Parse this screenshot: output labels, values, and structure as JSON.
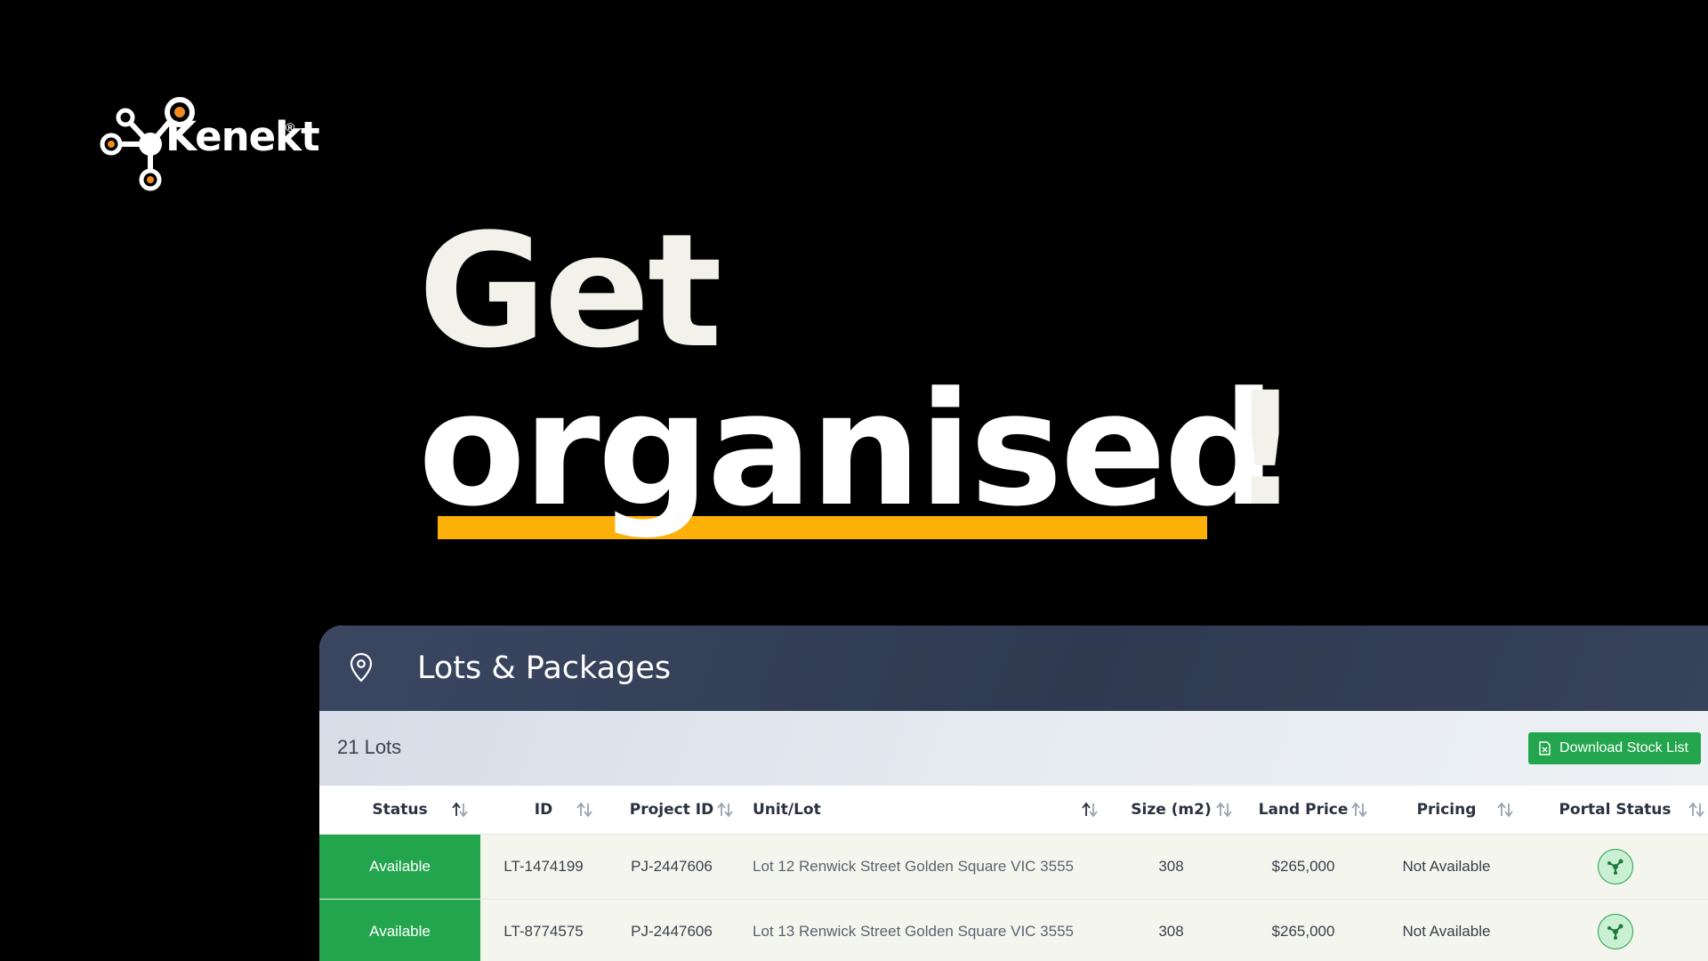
{
  "brand": {
    "name": "Kenekt",
    "reg": "®"
  },
  "hero": {
    "line1": "Get",
    "line2": "organised",
    "bang": "!"
  },
  "panel": {
    "title": "Lots & Packages",
    "lots_count": "21 Lots",
    "download_label": "Download Stock List",
    "columns": [
      "Status",
      "ID",
      "Project ID",
      "Unit/Lot",
      "Size (m2)",
      "Land Price",
      "Pricing",
      "Portal Status"
    ],
    "rows": [
      {
        "status": "Available",
        "id": "LT-1474199",
        "project_id": "PJ-2447606",
        "unit": "Lot 12 Renwick Street Golden Square VIC 3555",
        "size": "308",
        "price": "$265,000",
        "pricing": "Not Available"
      },
      {
        "status": "Available",
        "id": "LT-8774575",
        "project_id": "PJ-2447606",
        "unit": "Lot 13 Renwick Street Golden Square VIC 3555",
        "size": "308",
        "price": "$265,000",
        "pricing": "Not Available"
      }
    ]
  },
  "colors": {
    "accent_orange": "#fdb008",
    "status_green": "#23a54d",
    "header_navy": "#2f3a51",
    "logo_orange": "#f28b24"
  }
}
